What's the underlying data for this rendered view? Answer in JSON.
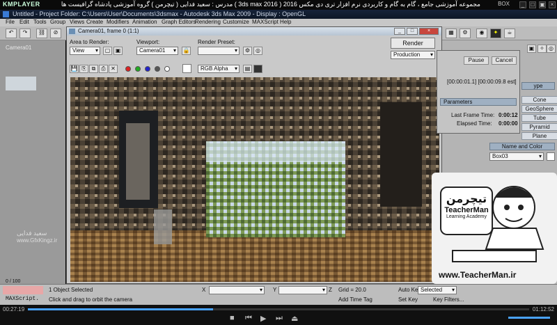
{
  "kmplayer": {
    "logo": "KMPLAYER",
    "title": "مجموعه آموزشی جامع ، گام به گام و کاربردی نرم افزار تری دی مکس 2016 ( 3ds max 2016 ) مدرس : سعید فدایی ( تیچرمن ) گروه آموزشی پادشاه گرافیست ها",
    "box_label": "BOX",
    "time_current": "00:27:19",
    "time_total": "01:12:52"
  },
  "max": {
    "title": "Untitled   - Project Folder: C:\\Users\\User\\Documents\\3dsmax   - Autodesk 3ds Max 2009   - Display : OpenGL",
    "menu": [
      "File",
      "Edit",
      "Tools",
      "Group",
      "Views",
      "Create",
      "Modifiers",
      "Animation",
      "Graph Editors",
      "Rendering",
      "Customize",
      "MAXScript",
      "Help"
    ],
    "viewport_label": "Camera01",
    "status": {
      "selected": "1 Object Selected",
      "prompt": "Click and drag to orbit the camera",
      "maxscript": "MAXScript.",
      "x_label": "X",
      "y_label": "Y",
      "z_label": "Z",
      "grid": "Grid = 20.0",
      "add_time_tag": "Add Time Tag",
      "auto_key": "Auto Key",
      "selected_dd": "Selected",
      "set_key": "Set Key",
      "key_filters": "Key Filters...",
      "frame_range": "0 / 100"
    }
  },
  "render_window": {
    "title": "Camera01, frame 0 (1:1)",
    "area_label": "Area to Render:",
    "area_value": "View",
    "viewport_label": "Viewport:",
    "viewport_value": "Camera01",
    "preset_label": "Render Preset:",
    "preset_value": "",
    "render_button": "Render",
    "production_value": "Production",
    "channel_value": "RGB Alpha"
  },
  "progress_dialog": {
    "pause": "Pause",
    "cancel": "Cancel",
    "time_range": "[00:00:01.1] [00:00:09.8 est]",
    "params_header": "Parameters",
    "last_frame_label": "Last Frame Time:",
    "last_frame_value": "0:00:12",
    "elapsed_label": "Elapsed Time:",
    "elapsed_value": "0:00:00"
  },
  "command_panel": {
    "type_header": "ype",
    "objects": [
      "Cone",
      "GeoSphere",
      "Tube",
      "Pyramid",
      "Plane"
    ],
    "name_color_header": "Name and Color",
    "object_name": "Box03"
  },
  "overlay": {
    "url": "www.TeacherMan.ir",
    "badge_fa": "تیچرمن",
    "badge_en": "TeacherMan",
    "badge_sub": "Learning Academy",
    "watermark_fa": "سعید فدایی",
    "watermark_url": "www.GfxKingz.ir"
  },
  "colors": {
    "accent_blue": "#9fb0c2",
    "title_dark": "#16233a",
    "panel_gray": "#c9c9c9",
    "kmp_black": "#0a0a0a"
  }
}
